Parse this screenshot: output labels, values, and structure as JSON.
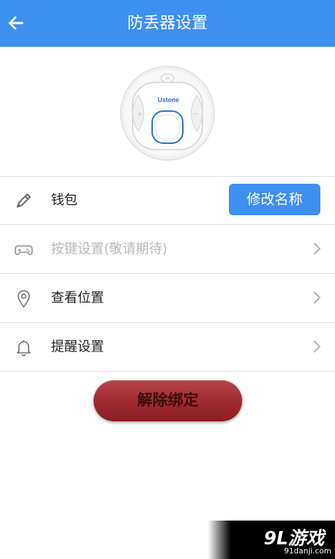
{
  "header": {
    "title": "防丢器设置",
    "back_icon": "arrow-left-icon"
  },
  "device": {
    "brand": "Ustone",
    "image": "tracker-device-image"
  },
  "rows": [
    {
      "label": "钱包",
      "icon": "pencil-icon",
      "action_label": "修改名称"
    },
    {
      "label": "按键设置(敬请期待)",
      "icon": "gamepad-icon",
      "disabled": true
    },
    {
      "label": "查看位置",
      "icon": "location-pin-icon"
    },
    {
      "label": "提醒设置",
      "icon": "bell-icon"
    }
  ],
  "unbind_button": {
    "label": "解除绑定"
  },
  "watermark": {
    "main": "9L游戏",
    "sub": "91danji.com"
  },
  "colors": {
    "primary": "#3d8ff0",
    "unbind": "#a02b32",
    "divider": "#dddddd"
  }
}
